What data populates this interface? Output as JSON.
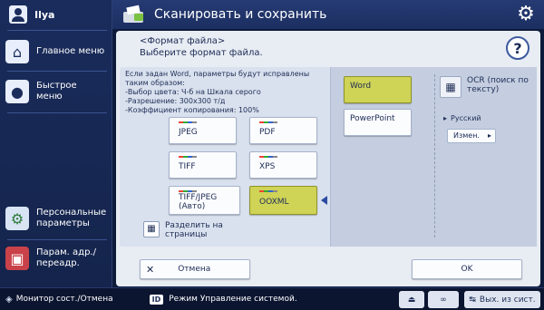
{
  "user": {
    "name": "Ilya"
  },
  "header": {
    "title": "Сканировать и сохранить"
  },
  "sidebar": {
    "items": [
      {
        "label": "Главное меню",
        "icon": "home-icon"
      },
      {
        "label": "Быстрое меню",
        "icon": "quick-menu-icon"
      },
      {
        "label": "Персональные параметры",
        "icon": "personal-settings-icon"
      },
      {
        "label": "Парам. адр./переадр.",
        "icon": "address-book-icon"
      }
    ]
  },
  "main": {
    "heading": "<Формат файла>",
    "subheading": "Выберите формат файла.",
    "info": "Если задан Word, параметры будут исправлены таким образом:\n-Выбор цвета: Ч-б на Шкала серого\n-Разрешение: 300x300 т/д\n-Коэффициент копирования: 100%",
    "formats": [
      {
        "label": "JPEG"
      },
      {
        "label": "PDF"
      },
      {
        "label": "TIFF"
      },
      {
        "label": "XPS"
      },
      {
        "label": "TIFF/JPEG (Авто)"
      },
      {
        "label": "OOXML",
        "selected": true
      }
    ],
    "split": "Разделить на страницы",
    "options": [
      {
        "label": "Word",
        "selected": true
      },
      {
        "label": "PowerPoint"
      }
    ],
    "ocr": "OCR (поиск по тексту)",
    "language": "Русский",
    "change": "Измен.",
    "cancel": "Отмена",
    "ok": "OK"
  },
  "status": {
    "monitor": "Монитор сост./Отмена",
    "mode": "Режим Управление системой.",
    "logout": "Вых. из сист."
  },
  "colors": {
    "selected": "#cfd356",
    "navy": "#14244c"
  }
}
